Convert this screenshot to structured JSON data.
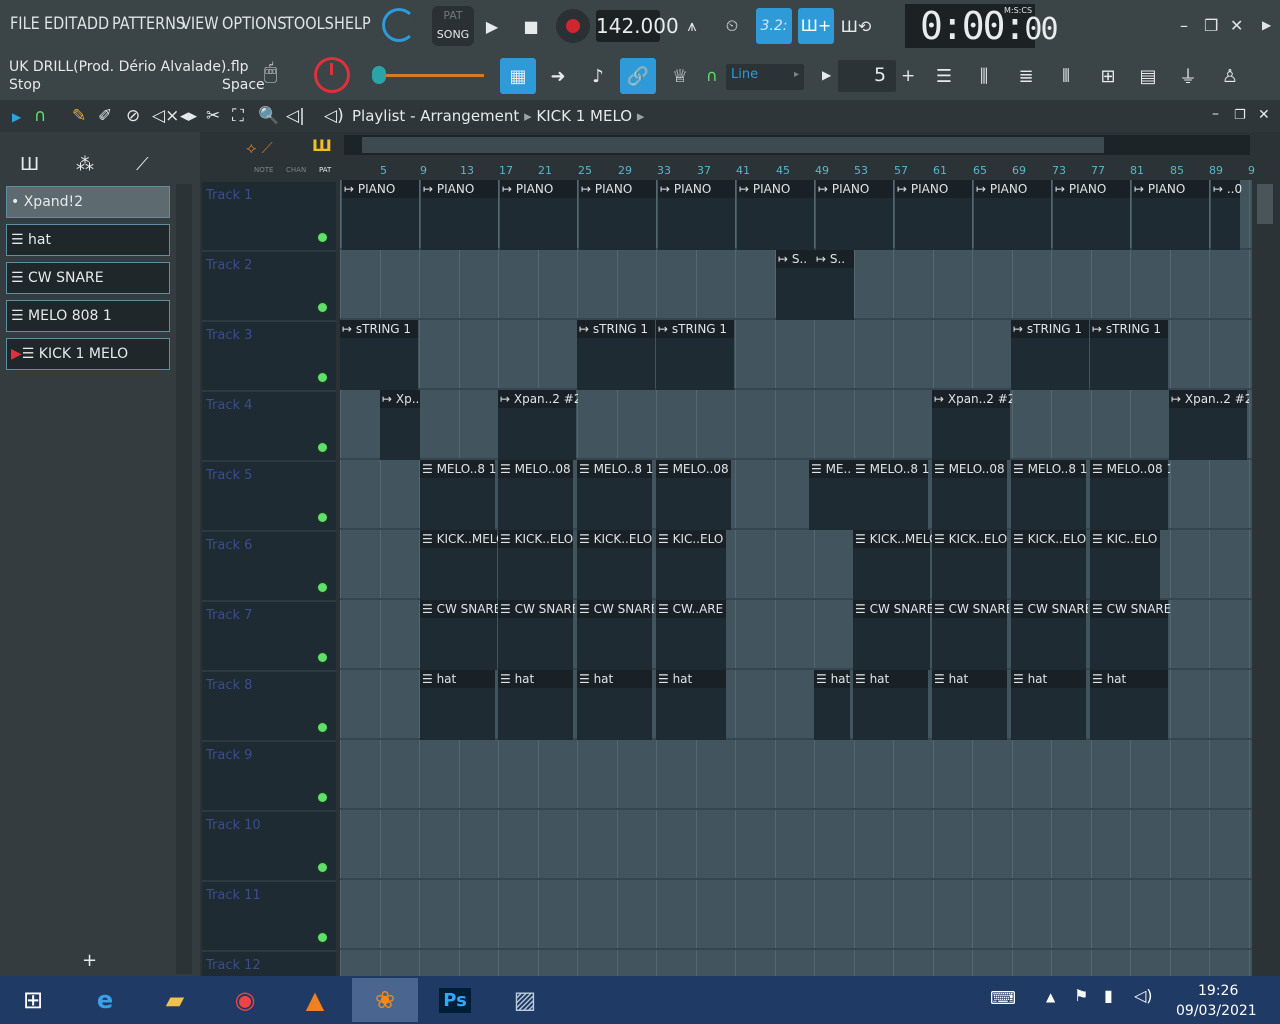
{
  "menu": [
    "FILE",
    "EDIT",
    "ADD",
    "PATTERNS",
    "VIEW",
    "OPTIONS",
    "TOOLS",
    "HELP"
  ],
  "transport": {
    "pat_label": "PAT",
    "song_label": "SONG",
    "tempo": "142.000",
    "time_main": "0:00",
    "time_sub": "00",
    "time_format": "M:S:CS",
    "snap_ratio": "3.2:"
  },
  "song": {
    "filename": "UK DRILL(Prod. Dério Alvalade).flp",
    "status": "Stop",
    "hint_key": "Space"
  },
  "toolbar2": {
    "snap_mode": "Line",
    "pattern_number": "5",
    "plus": "+"
  },
  "playlist": {
    "title": "Playlist - Arrangement",
    "current_pattern": "KICK 1 MELO",
    "tabs": {
      "note": "NOTE",
      "chan": "CHAN",
      "pat": "PAT"
    }
  },
  "browser": {
    "patterns": [
      "Xpand!2",
      "hat",
      "CW SNARE",
      "MELO 808 1",
      "KICK 1 MELO"
    ],
    "add_label": "+"
  },
  "ruler": [
    "5",
    "9",
    "13",
    "17",
    "21",
    "25",
    "29",
    "33",
    "37",
    "41",
    "45",
    "49",
    "53",
    "57",
    "61",
    "65",
    "69",
    "73",
    "77",
    "81",
    "85",
    "89",
    "9"
  ],
  "tracks": [
    "Track 1",
    "Track 2",
    "Track 3",
    "Track 4",
    "Track 5",
    "Track 6",
    "Track 7",
    "Track 8",
    "Track 9",
    "Track 10",
    "Track 11",
    "Track 12"
  ],
  "clips": {
    "piano": [
      "PIANO",
      "PIANO",
      "PIANO",
      "PIANO",
      "PIANO",
      "PIANO",
      "PIANO",
      "PIANO",
      "PIANO",
      "PIANO",
      "PIANO",
      "..0"
    ],
    "track2": [
      "S..",
      "S.."
    ],
    "string": [
      "sTRING 1",
      "sTRING 1",
      "sTRING 1",
      "sTRING 1",
      "sTRING 1"
    ],
    "xpand": [
      "Xp..",
      "Xpan..2 #2",
      "Xpan..2 #2",
      "Xpan..2 #2"
    ],
    "melo": [
      "MELO..8 1",
      "MELO..08 1",
      "MELO..8 1",
      "MELO..08 1",
      "ME..",
      "MELO..8 1",
      "MELO..08 1",
      "MELO..8 1",
      "MELO..08 1"
    ],
    "kick": [
      "KICK..MELO",
      "KICK..ELO",
      "KICK..ELO",
      "KIC..ELO",
      "KICK..MELO",
      "KICK..ELO",
      "KICK..ELO",
      "KIC..ELO"
    ],
    "snare": [
      "CW SNARE",
      "CW SNARE",
      "CW SNARE",
      "CW..ARE",
      "CW SNARE",
      "CW SNARE",
      "CW SNARE",
      "CW SNARE"
    ],
    "hat": [
      "hat",
      "hat",
      "hat",
      "hat",
      "hat",
      "hat",
      "hat",
      "hat",
      "hat"
    ]
  },
  "taskbar": {
    "time": "19:26",
    "date": "09/03/2021"
  },
  "colors": {
    "accent": "#2e9ad8",
    "led": "#5ee06a",
    "grid": "#42545d",
    "clip": "#1f2b32"
  }
}
